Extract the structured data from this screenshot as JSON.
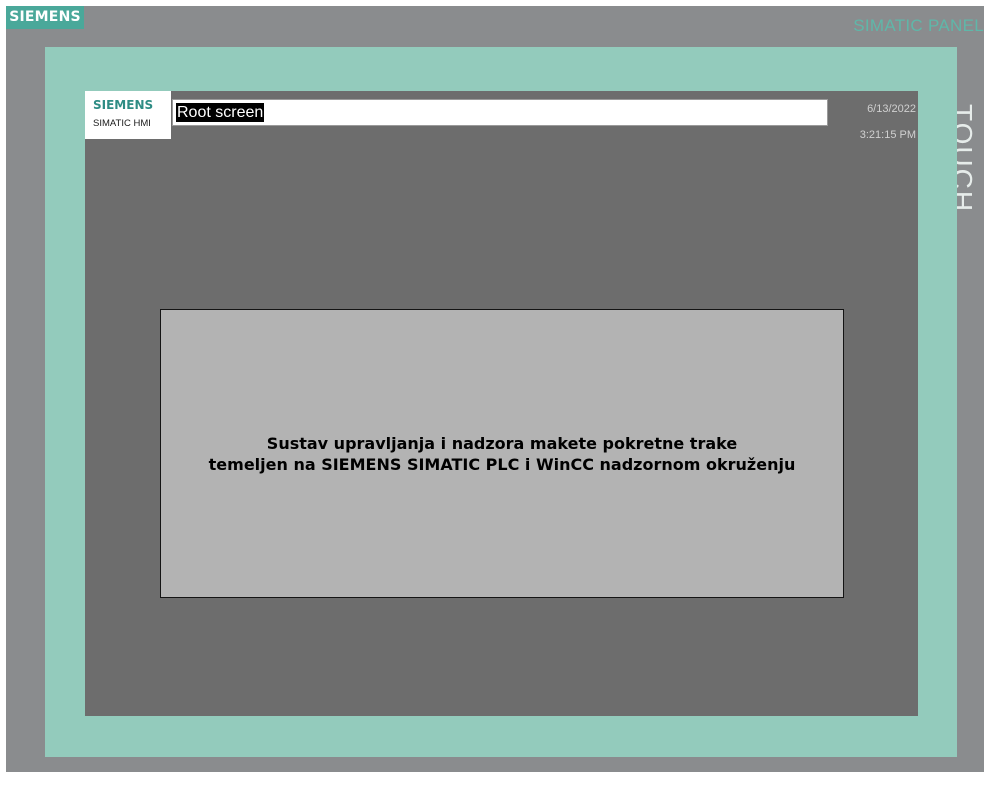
{
  "device": {
    "brand": "SIEMENS",
    "product": "SIMATIC PANEL",
    "touch_label": "TOUCH"
  },
  "hmi": {
    "logo_brand": "SIEMENS",
    "logo_product": "SIMATIC HMI",
    "screen_title": "Root screen",
    "date": "6/13/2022",
    "time": "3:21:15 PM",
    "info_lines": [
      "Sustav upravljanja i nadzora makete pokretne trake",
      "temeljen na SIEMENS SIMATIC PLC i WinCC nadzornom okruženju"
    ]
  },
  "colors": {
    "device_frame": "#8a8c8e",
    "bezel": "#93cbbc",
    "hmi_background": "#6d6d6d",
    "info_panel": "#b3b3b3",
    "brand_accent": "#4aa89a"
  }
}
